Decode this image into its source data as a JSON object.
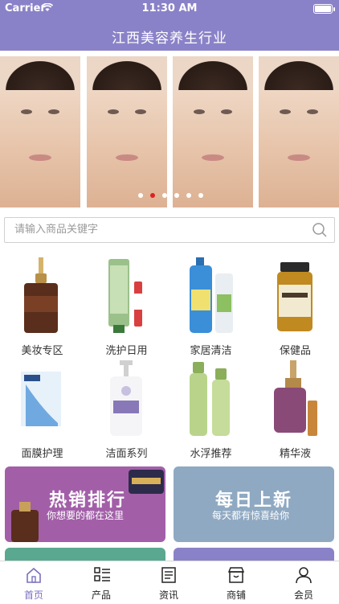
{
  "status_bar": {
    "carrier": "Carrier",
    "time": "11:30 AM"
  },
  "nav": {
    "title": "江西美容养生行业"
  },
  "banner": {
    "dot_count": 6,
    "active_dot": 1
  },
  "search": {
    "placeholder": "请输入商品关键字"
  },
  "categories": [
    {
      "label": "美妆专区",
      "icon": "serum-bottle-icon"
    },
    {
      "label": "洗护日用",
      "icon": "tube-icon"
    },
    {
      "label": "家居清洁",
      "icon": "detergent-icon"
    },
    {
      "label": "保健品",
      "icon": "supplement-jar-icon"
    },
    {
      "label": "面膜护理",
      "icon": "face-mask-icon"
    },
    {
      "label": "洁面系列",
      "icon": "pump-bottle-icon"
    },
    {
      "label": "水浮推荐",
      "icon": "toner-bottles-icon"
    },
    {
      "label": "精华液",
      "icon": "perfume-bottle-icon"
    }
  ],
  "promos": [
    {
      "title": "热销排行",
      "subtitle": "你想要的都在这里",
      "color": "#a25fa8"
    },
    {
      "title": "每日上新",
      "subtitle": "每天都有惊喜给你",
      "color": "#8fa9c2"
    }
  ],
  "tabs": [
    {
      "label": "首页",
      "icon": "home-icon",
      "active": true
    },
    {
      "label": "产品",
      "icon": "grid-list-icon",
      "active": false
    },
    {
      "label": "资讯",
      "icon": "news-icon",
      "active": false
    },
    {
      "label": "商铺",
      "icon": "store-icon",
      "active": false
    },
    {
      "label": "会员",
      "icon": "user-icon",
      "active": false
    }
  ],
  "colors": {
    "brand": "#8a82c8",
    "active_tab": "#7a70c0",
    "active_dot": "#e02020"
  }
}
